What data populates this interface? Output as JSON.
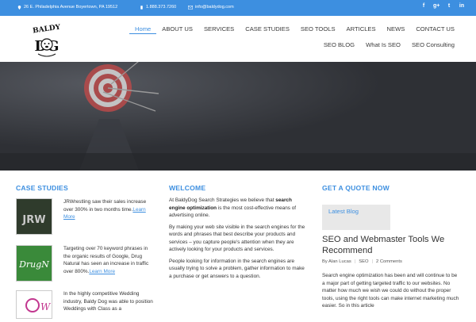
{
  "topbar": {
    "address": "26 E. Philadelphia Avenue Boyertown, PA 19512",
    "phone": "1.888.373.7260",
    "email": "info@baldydog.com",
    "social": [
      "f",
      "g+",
      "t",
      "in"
    ]
  },
  "logo": {
    "top": "BALDY",
    "bottom": "DG"
  },
  "nav": {
    "row1": [
      "Home",
      "ABOUT US",
      "SERVICES",
      "CASE STUDIES",
      "SEO TOOLS",
      "ARTICLES",
      "NEWS",
      "CONTACT US"
    ],
    "row2": [
      "SEO BLOG",
      "What Is SEO",
      "SEO Consulting"
    ]
  },
  "case_studies": {
    "title": "CASE STUDIES",
    "items": [
      {
        "text": "JRWrestling saw their sales increase over 300% in two months time.",
        "link": "Learn More",
        "thumb": "JRW"
      },
      {
        "text": "Targeting over 70 keyword phrases in the organic results of Google, Drug Natural has seen an increase in traffic over 800%.",
        "link": "Learn More",
        "thumb": "DrugN"
      },
      {
        "text": "In the highly competitive Wedding industry, Baldy Dog was able to position Weddings with Class as a",
        "link": "",
        "thumb": "W"
      }
    ]
  },
  "welcome": {
    "title": "WELCOME",
    "p1_pre": "At BaldyDog Search Strategies we believe that ",
    "p1_bold": "search engine optimization",
    "p1_post": " is the most cost-effective means of advertising online.",
    "p2": "By making your web site visible in the search engines for the words and phrases that best describe your products and services – you capture people's attention when they are actively looking for your products and services.",
    "p3": "People looking for information in the search engines are usually trying to solve a problem, gather information to make a purchase or get answers to a question."
  },
  "quote": {
    "title": "GET A QUOTE NOW",
    "latest_blog": "Latest Blog",
    "post_title": "SEO and Webmaster Tools We Recommend",
    "meta_author": "By Alan Lucas",
    "meta_cat": "SEO",
    "meta_comments": "2 Comments",
    "post_body": "Search engine optimization has been and will continue to be a major part of getting targeted traffic to our websites. No matter how much we wish we could do without the proper tools, using the right tools can make internet marketing much easier. So in this article"
  },
  "colors": {
    "accent": "#3d8fe0",
    "hero": "#2e3035"
  }
}
